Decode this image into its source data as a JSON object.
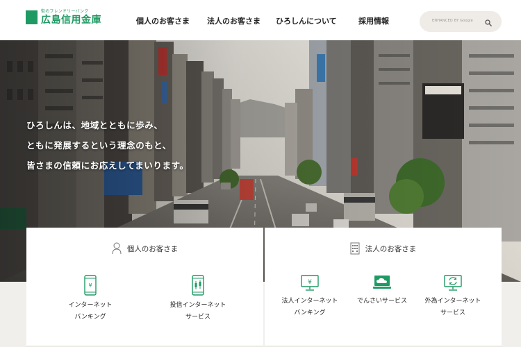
{
  "header": {
    "logo_tagline": "街のフレンドリーバンク",
    "logo_name": "広島信用金庫",
    "nav": [
      {
        "label": "個人のお客さま"
      },
      {
        "label": "法人のお客さま"
      },
      {
        "label": "ひろしんについて"
      },
      {
        "label": "採用情報"
      }
    ],
    "search": {
      "placeholder": "ENHANCED BY Google"
    }
  },
  "hero": {
    "lines": [
      "ひろしんは、地域とともに歩み、",
      "ともに発展するという理念のもと、",
      "皆さまの信頼にお応えしてまいります。"
    ]
  },
  "personal": {
    "title": "個人のお客さま",
    "services": [
      {
        "line1": "インターネット",
        "line2": "バンキング",
        "icon": "smartphone-yen-icon"
      },
      {
        "line1": "投信インターネット",
        "line2": "サービス",
        "icon": "smartphone-chart-icon"
      }
    ]
  },
  "corporate": {
    "title": "法人のお客さま",
    "services": [
      {
        "line1": "法人インターネット",
        "line2": "バンキング",
        "icon": "monitor-yen-icon"
      },
      {
        "line1": "でんさいサービス",
        "line2": "",
        "icon": "laptop-cloud-icon"
      },
      {
        "line1": "外為インターネット",
        "line2": "サービス",
        "icon": "monitor-exchange-icon"
      }
    ]
  },
  "colors": {
    "brand": "#1f9a63",
    "background": "#f1efec"
  }
}
